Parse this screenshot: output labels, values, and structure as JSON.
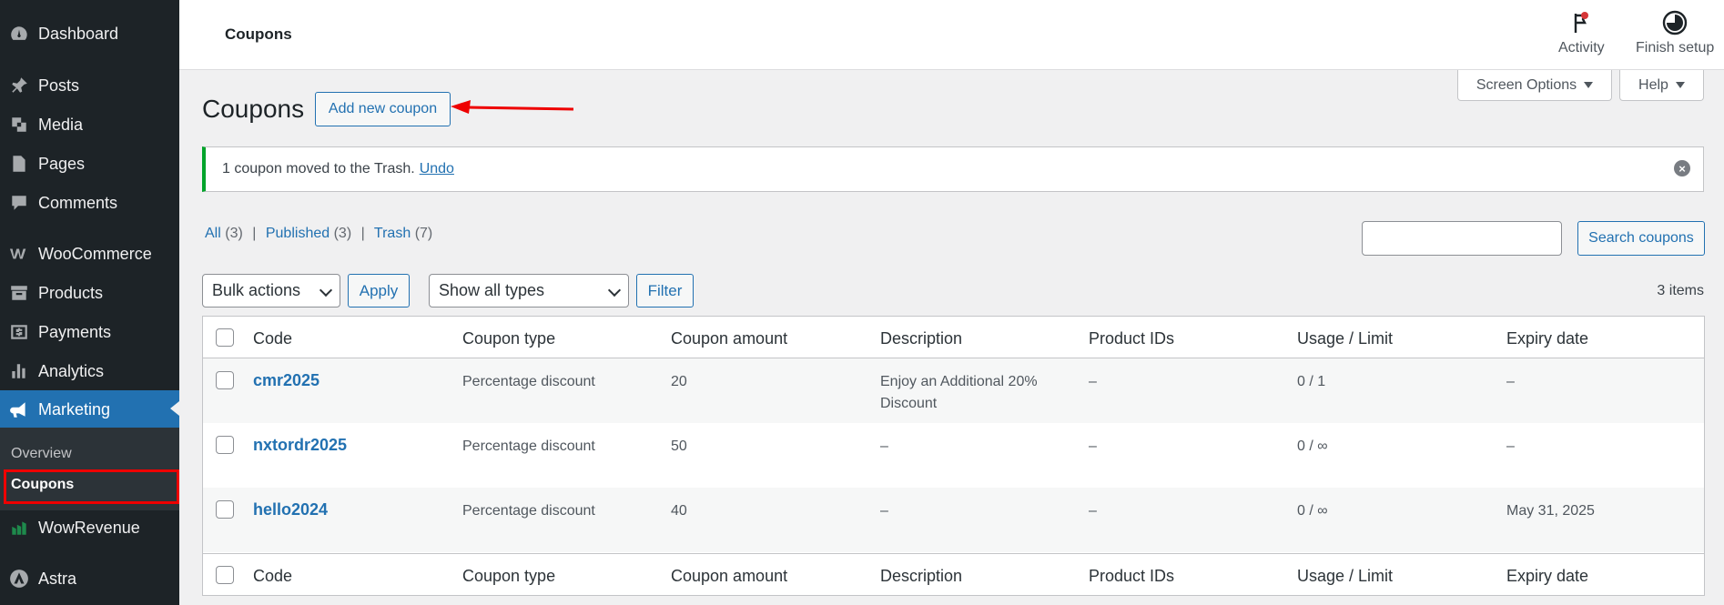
{
  "sidebar": {
    "items": [
      {
        "label": "Dashboard",
        "icon": "dashboard-icon"
      },
      {
        "label": "Posts",
        "icon": "pin-icon"
      },
      {
        "label": "Media",
        "icon": "media-icon"
      },
      {
        "label": "Pages",
        "icon": "pages-icon"
      },
      {
        "label": "Comments",
        "icon": "comment-icon"
      },
      {
        "label": "WooCommerce",
        "icon": "woo-icon"
      },
      {
        "label": "Products",
        "icon": "archive-icon"
      },
      {
        "label": "Payments",
        "icon": "dollar-icon"
      },
      {
        "label": "Analytics",
        "icon": "bar-chart-icon"
      },
      {
        "label": "Marketing",
        "icon": "megaphone-icon"
      },
      {
        "label": "WowRevenue",
        "icon": "wowrevenue-icon"
      },
      {
        "label": "Astra",
        "icon": "astra-icon"
      }
    ],
    "submenu": [
      {
        "label": "Overview"
      },
      {
        "label": "Coupons"
      }
    ]
  },
  "topbar": {
    "title": "Coupons",
    "activity_label": "Activity",
    "finish_setup_label": "Finish setup"
  },
  "screen_options_label": "Screen Options",
  "help_label": "Help",
  "heading": "Coupons",
  "add_new_label": "Add new coupon",
  "notice": {
    "text": "1 coupon moved to the Trash.",
    "undo": "Undo"
  },
  "views": {
    "all": "All",
    "all_count": "(3)",
    "published": "Published",
    "published_count": "(3)",
    "trash": "Trash",
    "trash_count": "(7)",
    "sep": "|"
  },
  "search": {
    "button_label": "Search coupons",
    "value": ""
  },
  "bulk_actions": {
    "selected": "Bulk actions",
    "apply": "Apply"
  },
  "type_filter": {
    "selected": "Show all types",
    "filter": "Filter"
  },
  "items_count": "3 items",
  "table": {
    "columns": [
      "Code",
      "Coupon type",
      "Coupon amount",
      "Description",
      "Product IDs",
      "Usage / Limit",
      "Expiry date"
    ],
    "rows": [
      {
        "code": "cmr2025",
        "type": "Percentage discount",
        "amount": "20",
        "description": "Enjoy an Additional 20%",
        "description2": "Discount",
        "product_ids": "–",
        "usage": "0 / 1",
        "expiry": "–"
      },
      {
        "code": "nxtordr2025",
        "type": "Percentage discount",
        "amount": "50",
        "description": "–",
        "description2": "",
        "product_ids": "–",
        "usage": "0 / ∞",
        "expiry": "–"
      },
      {
        "code": "hello2024",
        "type": "Percentage discount",
        "amount": "40",
        "description": "–",
        "description2": "",
        "product_ids": "–",
        "usage": "0 / ∞",
        "expiry": "May 31, 2025"
      }
    ]
  },
  "colors": {
    "accent": "#2271b1",
    "sidebar": "#1d2327",
    "success": "#00a32a",
    "annotation": "#e00000"
  }
}
